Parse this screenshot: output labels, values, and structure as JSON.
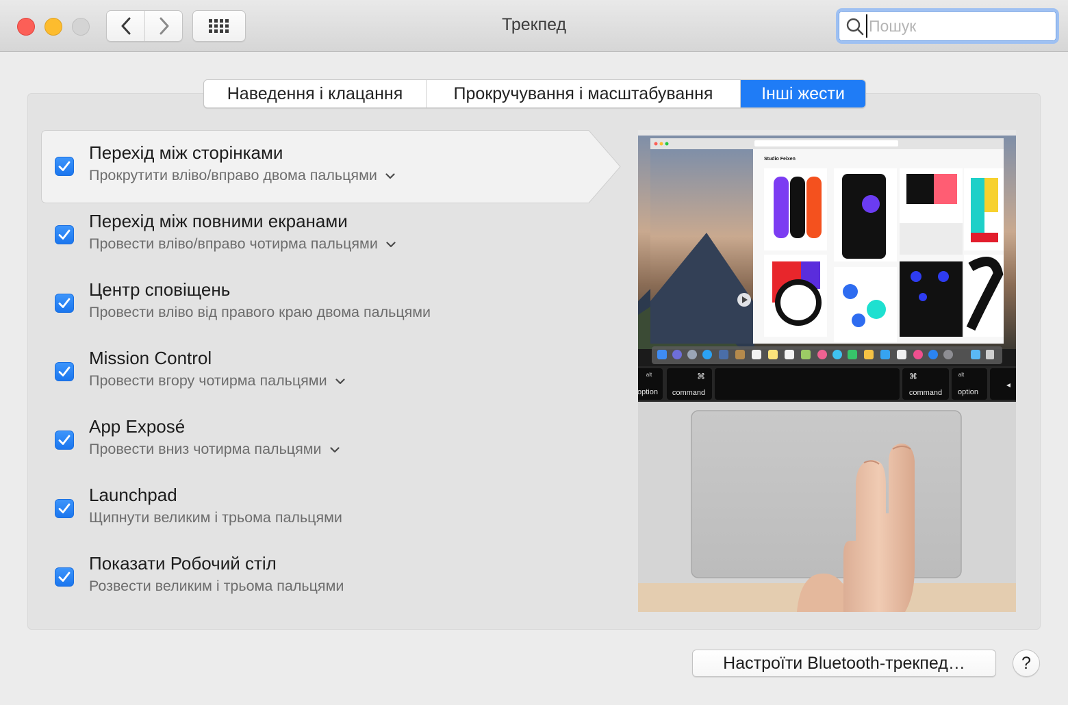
{
  "window": {
    "title": "Трекпед"
  },
  "search": {
    "placeholder": "Пошук",
    "value": ""
  },
  "tabs": [
    {
      "label": "Наведення і клацання",
      "active": false
    },
    {
      "label": "Прокручування і масштабування",
      "active": false
    },
    {
      "label": "Інші жести",
      "active": true
    }
  ],
  "gestures": [
    {
      "title": "Перехід між сторінками",
      "subtitle": "Прокрутити вліво/вправо двома пальцями",
      "checked": true,
      "has_menu": true,
      "selected": true
    },
    {
      "title": "Перехід між повними екранами",
      "subtitle": "Провести вліво/вправо чотирма пальцями",
      "checked": true,
      "has_menu": true,
      "selected": false
    },
    {
      "title": "Центр сповіщень",
      "subtitle": "Провести вліво від правого краю двома пальцями",
      "checked": true,
      "has_menu": false,
      "selected": false
    },
    {
      "title": "Mission Control",
      "subtitle": "Провести вгору чотирма пальцями",
      "checked": true,
      "has_menu": true,
      "selected": false
    },
    {
      "title": "App Exposé",
      "subtitle": "Провести вниз чотирма пальцями",
      "checked": true,
      "has_menu": true,
      "selected": false
    },
    {
      "title": "Launchpad",
      "subtitle": "Щипнути великим і трьома пальцями",
      "checked": true,
      "has_menu": false,
      "selected": false
    },
    {
      "title": "Показати Робочий стіл",
      "subtitle": "Розвести великим і трьома пальцями",
      "checked": true,
      "has_menu": false,
      "selected": false
    }
  ],
  "preview": {
    "site_title": "Studio Feixen",
    "keys": {
      "left_alt": "alt",
      "left_option": "option",
      "left_cmd_symbol": "⌘",
      "left_command": "command",
      "right_cmd_symbol": "⌘",
      "right_command": "command",
      "right_alt": "alt",
      "right_option": "option"
    }
  },
  "buttons": {
    "bluetooth": "Настроїти Bluetooth-трекпед…",
    "help": "?"
  },
  "colors": {
    "accent": "#1f7cf6",
    "close": "#fc5f57",
    "minimize": "#fdbc2e",
    "zoom_disabled": "#d4d4d4"
  },
  "icons": {
    "back": "chevron-left-icon",
    "forward": "chevron-right-icon",
    "grid": "grid-icon",
    "search": "search-icon",
    "check": "checkmark-icon",
    "menu": "chevron-down-icon"
  }
}
